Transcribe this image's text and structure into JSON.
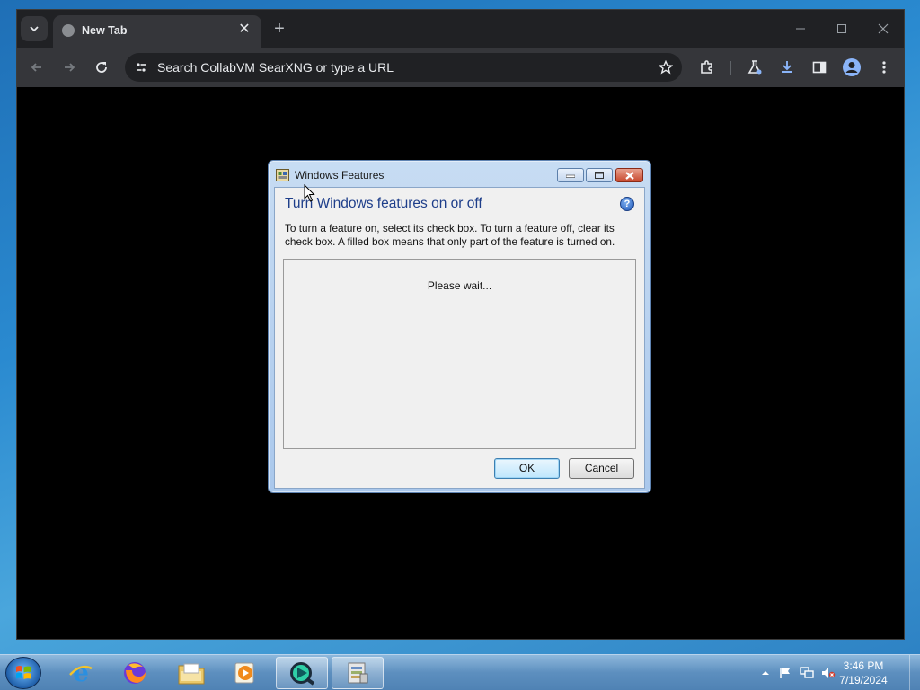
{
  "browser": {
    "tab_title": "New Tab",
    "tab_close": "✕",
    "new_tab": "+",
    "omnibox_text": "Search CollabVM SearXNG or type a URL"
  },
  "dialog": {
    "title": "Windows Features",
    "heading": "Turn Windows features on or off",
    "description": "To turn a feature on, select its check box. To turn a feature off, clear its check box. A filled box means that only part of the feature is turned on.",
    "loading_text": "Please wait...",
    "ok_label": "OK",
    "cancel_label": "Cancel",
    "help": "?"
  },
  "taskbar": {
    "items": [
      "internet-explorer",
      "firefox",
      "windows-explorer",
      "media-player",
      "app-active",
      "windows-features"
    ],
    "clock_time": "3:46 PM",
    "clock_date": "7/19/2024"
  },
  "colors": {
    "browser_frame": "#202124",
    "toolbar": "#35363a",
    "dialog_heading": "#1e3e8a",
    "download_accent": "#8ab4f8"
  }
}
